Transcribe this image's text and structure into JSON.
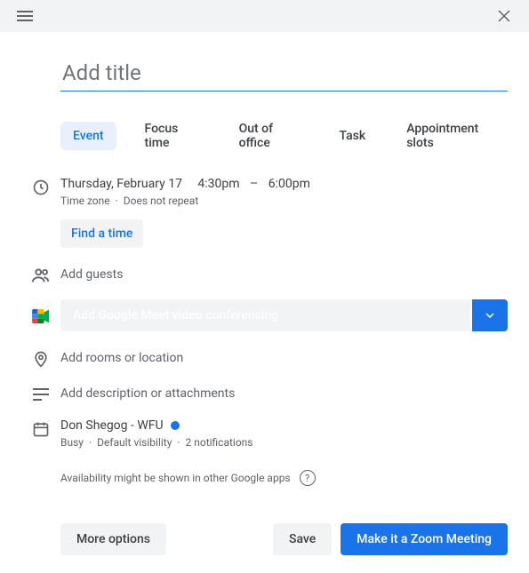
{
  "header": {},
  "title": {
    "placeholder": "Add title",
    "value": ""
  },
  "tabs": {
    "event": "Event",
    "focus": "Focus time",
    "ooo": "Out of office",
    "task": "Task",
    "appointment": "Appointment slots"
  },
  "time": {
    "date": "Thursday, February 17",
    "start": "4:30pm",
    "sep": "–",
    "end": "6:00pm",
    "timezone": "Time zone",
    "dot": "·",
    "repeat": "Does not repeat",
    "find": "Find a time"
  },
  "guests": {
    "placeholder": "Add guests"
  },
  "meet": {
    "label": "Add Google Meet video conferencing"
  },
  "location": {
    "placeholder": "Add rooms or location"
  },
  "description": {
    "placeholder": "Add description or attachments"
  },
  "calendar": {
    "organizer": "Don Shegog - WFU",
    "busy": "Busy",
    "visibility": "Default visibility",
    "notifications": "2 notifications"
  },
  "availability": {
    "text": "Availability might be shown in other Google apps",
    "help": "?"
  },
  "footer": {
    "more": "More options",
    "save": "Save",
    "zoom": "Make it a Zoom Meeting"
  }
}
